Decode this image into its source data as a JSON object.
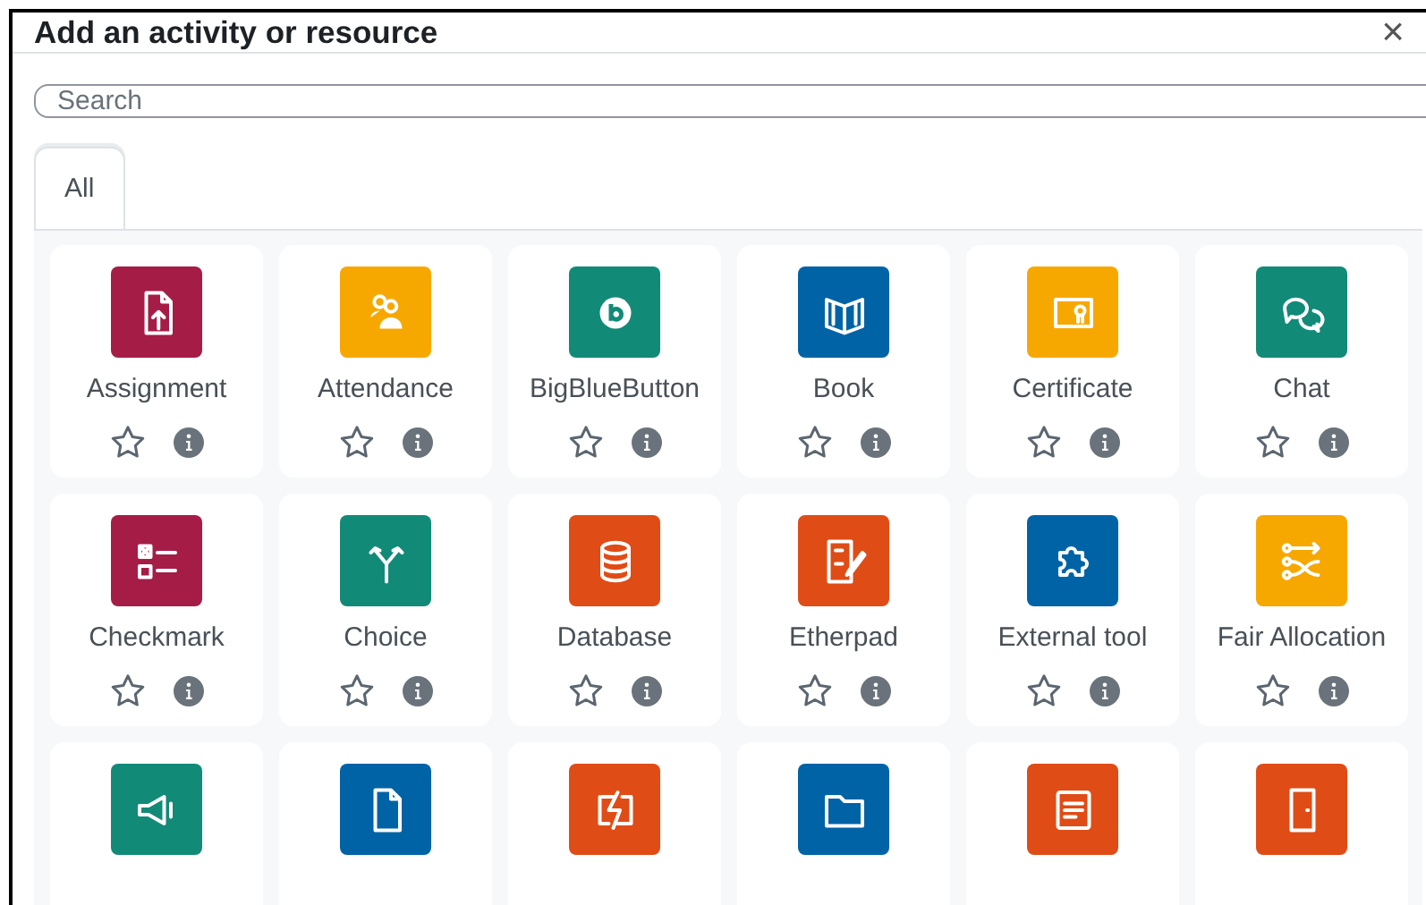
{
  "dialog": {
    "title": "Add an activity or resource",
    "close": "×"
  },
  "search": {
    "placeholder": "Search"
  },
  "tabs": [
    {
      "label": "All",
      "selected": true
    }
  ],
  "items": [
    {
      "label": "Assignment",
      "color": "#a51d47",
      "starred": false
    },
    {
      "label": "Attendance",
      "color": "#f7a800",
      "starred": false
    },
    {
      "label": "BigBlueButton",
      "color": "#128a78",
      "starred": false
    },
    {
      "label": "Book",
      "color": "#0063a6",
      "starred": false
    },
    {
      "label": "Certificate",
      "color": "#f7a800",
      "starred": false
    },
    {
      "label": "Chat",
      "color": "#128a78",
      "starred": false
    },
    {
      "label": "Checkmark",
      "color": "#a51d47",
      "starred": false
    },
    {
      "label": "Choice",
      "color": "#128a78",
      "starred": false
    },
    {
      "label": "Database",
      "color": "#e04c16",
      "starred": false
    },
    {
      "label": "Etherpad",
      "color": "#e04c16",
      "starred": false
    },
    {
      "label": "External tool",
      "color": "#0063a6",
      "starred": false
    },
    {
      "label": "Fair Allocation",
      "color": "#f7a800",
      "starred": false
    },
    {
      "color": "#128a78"
    },
    {
      "color": "#0063a6"
    },
    {
      "color": "#e04c16"
    },
    {
      "color": "#0063a6"
    },
    {
      "color": "#e04c16"
    },
    {
      "color": "#e04c16"
    }
  ]
}
